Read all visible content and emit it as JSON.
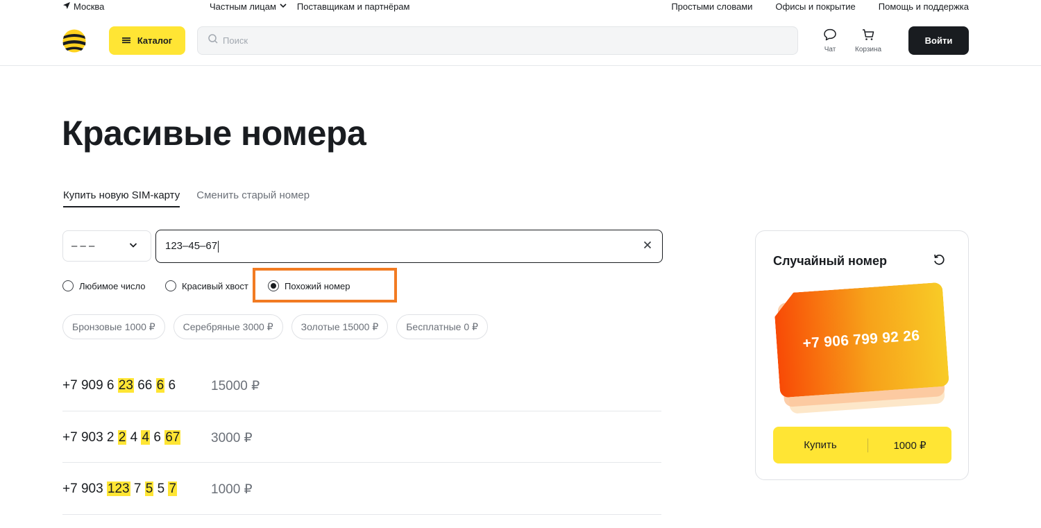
{
  "topbar": {
    "city": "Москва",
    "nav_left": [
      "Частным лицам",
      "Поставщикам и партнёрам"
    ],
    "nav_right": [
      "Простыми словами",
      "Офисы и покрытие",
      "Помощь и поддержка"
    ]
  },
  "header": {
    "catalog_label": "Каталог",
    "search_placeholder": "Поиск",
    "chat_label": "Чат",
    "cart_label": "Корзина",
    "login_label": "Войти"
  },
  "page": {
    "title": "Красивые номера"
  },
  "tabs": [
    {
      "label": "Купить новую SIM-карту",
      "active": true
    },
    {
      "label": "Сменить старый номер",
      "active": false
    }
  ],
  "search_row": {
    "prefix_value": "– – –",
    "number_value": "123–45–67"
  },
  "radios": [
    {
      "label": "Любимое число",
      "selected": false
    },
    {
      "label": "Красивый хвост",
      "selected": false
    },
    {
      "label": "Похожий номер",
      "selected": true
    }
  ],
  "chips": [
    "Бронзовые 1000 ₽",
    "Серебряные 3000 ₽",
    "Золотые 15000 ₽",
    "Бесплатные 0 ₽"
  ],
  "numbers": [
    {
      "parts": [
        [
          "+7 909 6 ",
          false
        ],
        [
          "23",
          true
        ],
        [
          " 66 ",
          false
        ],
        [
          "6",
          true
        ],
        [
          " 6",
          false
        ]
      ],
      "price": "15000 ₽"
    },
    {
      "parts": [
        [
          "+7 903 2 ",
          false
        ],
        [
          "2",
          true
        ],
        [
          " 4 ",
          false
        ],
        [
          "4",
          true
        ],
        [
          " 6 ",
          false
        ],
        [
          "67",
          true
        ]
      ],
      "price": "3000 ₽"
    },
    {
      "parts": [
        [
          "+7 903 ",
          false
        ],
        [
          "123",
          true
        ],
        [
          " 7 ",
          false
        ],
        [
          "5",
          true
        ],
        [
          " 5 ",
          false
        ],
        [
          "7",
          true
        ]
      ],
      "price": "1000 ₽"
    }
  ],
  "random_card": {
    "title": "Случайный номер",
    "sim_number": "+7 906 799 92 26",
    "buy_label": "Купить",
    "price": "1000 ₽"
  },
  "colors": {
    "accent_yellow": "#ffe534",
    "highlight_orange": "#f27b22",
    "text_dark": "#191c20"
  }
}
